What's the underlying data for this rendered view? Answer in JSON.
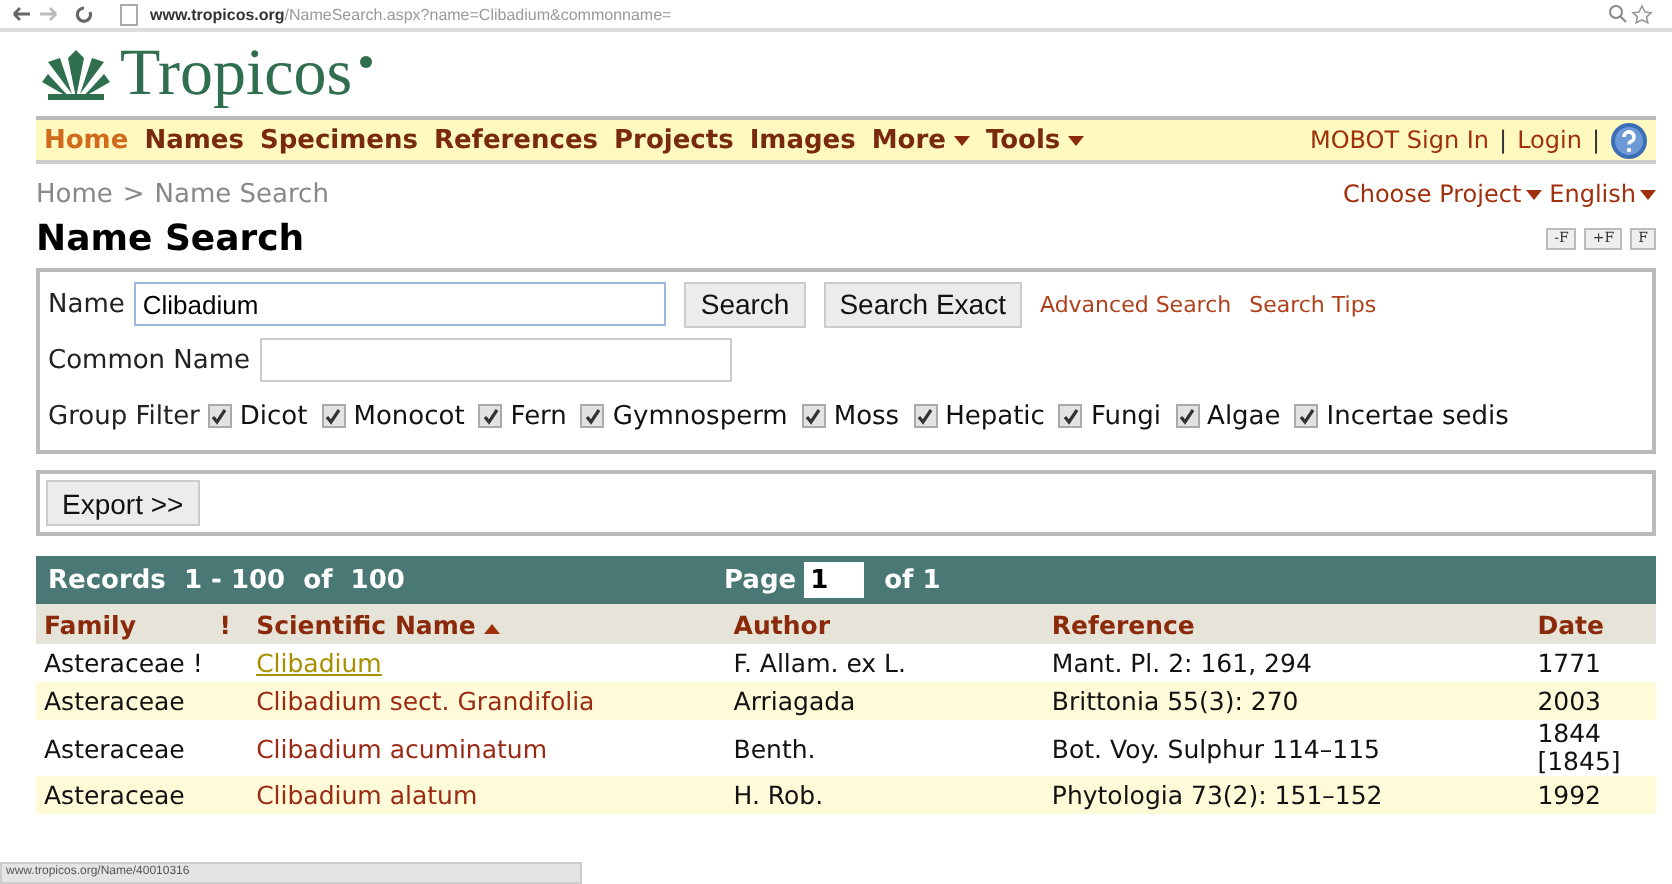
{
  "browser": {
    "url_host": "www.tropicos.org",
    "url_path": "/NameSearch.aspx?name=Clibadium&commonname="
  },
  "logo": {
    "name": "Tropicos"
  },
  "nav": {
    "items": [
      {
        "label": "Home",
        "selected": true,
        "dropdown": false
      },
      {
        "label": "Names",
        "selected": false,
        "dropdown": false
      },
      {
        "label": "Specimens",
        "selected": false,
        "dropdown": false
      },
      {
        "label": "References",
        "selected": false,
        "dropdown": false
      },
      {
        "label": "Projects",
        "selected": false,
        "dropdown": false
      },
      {
        "label": "Images",
        "selected": false,
        "dropdown": false
      },
      {
        "label": "More",
        "selected": false,
        "dropdown": true
      },
      {
        "label": "Tools",
        "selected": false,
        "dropdown": true
      }
    ],
    "sign_in": "MOBOT Sign In",
    "separator": "|",
    "login": "Login"
  },
  "breadcrumb": {
    "home": "Home",
    "separator": ">",
    "current": "Name Search"
  },
  "project_menu": [
    "Choose Project",
    "English"
  ],
  "page_title": "Name Search",
  "font_buttons": [
    "-F",
    "+F",
    "F"
  ],
  "search": {
    "name_label": "Name",
    "name_value": "Clibadium",
    "search_button": "Search",
    "exact_button": "Search Exact",
    "links": [
      "Advanced Search",
      "Search Tips"
    ],
    "common_label": "Common Name",
    "group_label": "Group Filter",
    "groups": [
      {
        "label": "Dicot",
        "checked": true
      },
      {
        "label": "Monocot",
        "checked": true
      },
      {
        "label": "Fern",
        "checked": true
      },
      {
        "label": "Gymnosperm",
        "checked": true
      },
      {
        "label": "Moss",
        "checked": true
      },
      {
        "label": "Hepatic",
        "checked": true
      },
      {
        "label": "Fungi",
        "checked": true
      },
      {
        "label": "Algae",
        "checked": true
      },
      {
        "label": "Incertae sedis",
        "checked": true
      }
    ]
  },
  "export_button": "Export >>",
  "results": {
    "records": "Records  1 - 100  of  100",
    "page_label": "Page",
    "page_value": "1",
    "page_of": "of 1",
    "columns": [
      "Family",
      "!",
      "Scientific Name",
      "Author",
      "Reference",
      "Date"
    ],
    "rows": [
      {
        "family": "Asteraceae !",
        "name": "Clibadium",
        "hovered": true,
        "author": "F. Allam. ex L.",
        "reference": "Mant. Pl. 2: 161, 294",
        "date": [
          "1771"
        ]
      },
      {
        "family": "Asteraceae",
        "name": "Clibadium sect. Grandifolia",
        "hovered": false,
        "author": "Arriagada",
        "reference": "Brittonia 55(3): 270",
        "date": [
          "2003"
        ]
      },
      {
        "family": "Asteraceae",
        "name": "Clibadium acuminatum",
        "hovered": false,
        "author": "Benth.",
        "reference": "Bot. Voy. Sulphur 114–115",
        "date": [
          "1844",
          "[1845]"
        ]
      },
      {
        "family": "Asteraceae",
        "name": "Clibadium alatum",
        "hovered": false,
        "author": "H. Rob.",
        "reference": "Phytologia 73(2): 151–152",
        "date": [
          "1992"
        ]
      }
    ]
  },
  "status_bar": "www.tropicos.org/Name/40010316"
}
